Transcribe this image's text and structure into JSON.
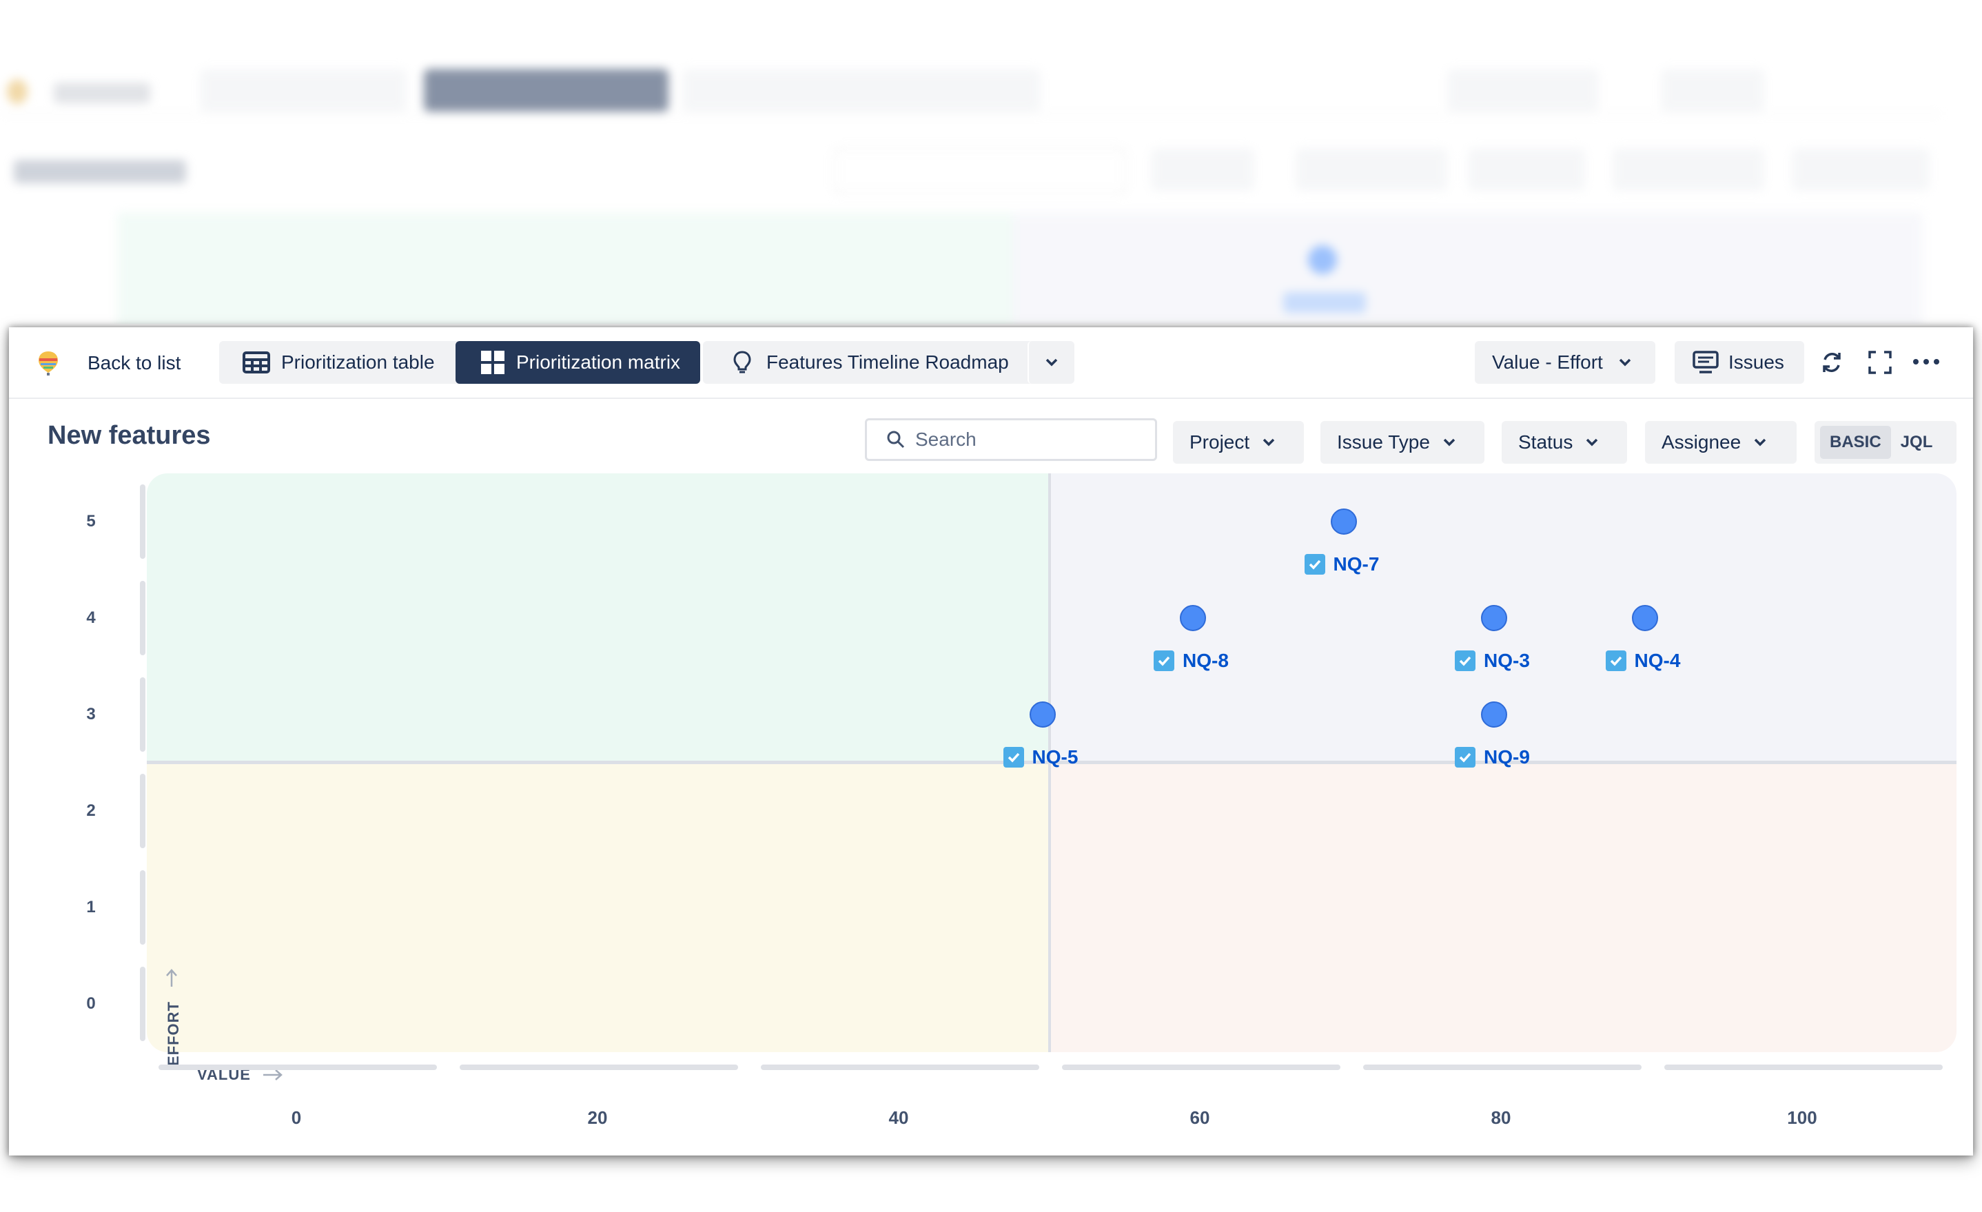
{
  "app": {
    "logo_icon": "roadmap-balloon-icon"
  },
  "toolbar": {
    "back_label": "Back to list",
    "tabs": [
      {
        "label": "Prioritization table",
        "icon": "table-icon",
        "active": false
      },
      {
        "label": "Prioritization matrix",
        "icon": "grid-icon",
        "active": true
      },
      {
        "label": "Features Timeline Roadmap",
        "icon": "lightbulb-icon",
        "active": false
      }
    ],
    "more_tabs_icon": "chevron-down-icon",
    "view_select": "Value - Effort",
    "issues_label": "Issues",
    "icons": [
      "sync-icon",
      "fullscreen-icon",
      "more-icon"
    ]
  },
  "page": {
    "title": "New features",
    "search_placeholder": "Search",
    "filters": [
      "Project",
      "Issue Type",
      "Status",
      "Assignee"
    ],
    "mode_toggle": {
      "basic": "BASIC",
      "jql": "JQL",
      "active": "BASIC"
    }
  },
  "chart_data": {
    "type": "scatter",
    "xlabel": "VALUE",
    "ylabel": "EFFORT",
    "xlim": [
      -10,
      110
    ],
    "ylim": [
      0,
      5
    ],
    "x_ticks": [
      "0",
      "20",
      "40",
      "60",
      "80",
      "100"
    ],
    "y_ticks": [
      "5",
      "4",
      "3",
      "2",
      "1",
      "0"
    ],
    "quadrant_split": {
      "x": 50,
      "y": 2.5
    },
    "quadrant_colors": {
      "top_left": "#ebf9f3",
      "top_right": "#f3f4f9",
      "bottom_left": "#fcf9e9",
      "bottom_right": "#fcf4f1"
    },
    "point_color": "#4b8cf7",
    "points": [
      {
        "key": "NQ-7",
        "x": 70,
        "y": 5
      },
      {
        "key": "NQ-8",
        "x": 60,
        "y": 4
      },
      {
        "key": "NQ-3",
        "x": 80,
        "y": 4
      },
      {
        "key": "NQ-4",
        "x": 90,
        "y": 4
      },
      {
        "key": "NQ-5",
        "x": 50,
        "y": 3
      },
      {
        "key": "NQ-9",
        "x": 80,
        "y": 3
      }
    ]
  }
}
